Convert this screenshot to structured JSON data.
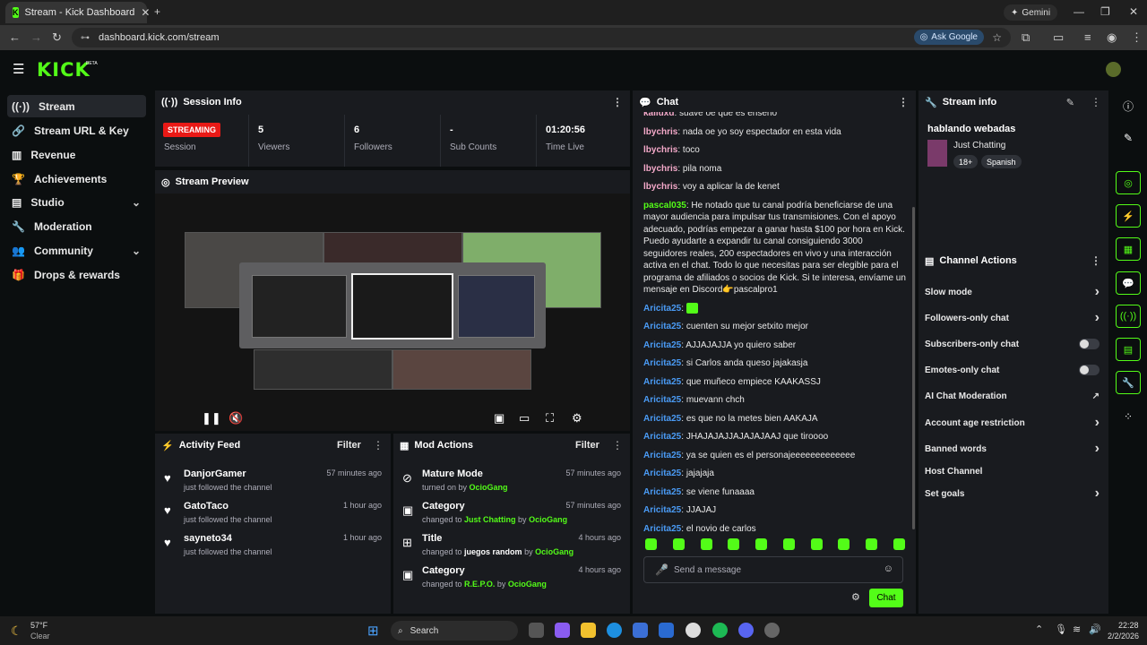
{
  "browser": {
    "tab_title": "Stream - Kick Dashboard",
    "url": "dashboard.kick.com/stream",
    "ask_google": "Ask Google",
    "gemini": "Gemini"
  },
  "header": {
    "logo": "KICK",
    "beta": "BETA"
  },
  "sidebar": {
    "items": [
      {
        "label": "Stream"
      },
      {
        "label": "Stream URL & Key"
      },
      {
        "label": "Revenue"
      },
      {
        "label": "Achievements"
      },
      {
        "label": "Studio"
      },
      {
        "label": "Moderation"
      },
      {
        "label": "Community"
      },
      {
        "label": "Drops & rewards"
      }
    ]
  },
  "session": {
    "title": "Session Info",
    "badge": "STREAMING",
    "session_label": "Session",
    "viewers_value": "5",
    "viewers_label": "Viewers",
    "followers_value": "6",
    "followers_label": "Followers",
    "subs_value": "-",
    "subs_label": "Sub Counts",
    "time_value": "01:20:56",
    "time_label": "Time Live"
  },
  "preview": {
    "title": "Stream Preview"
  },
  "activity": {
    "title": "Activity Feed",
    "filter": "Filter",
    "items": [
      {
        "name": "DanjorGamer",
        "sub": "just followed the channel",
        "time": "57 minutes ago"
      },
      {
        "name": "GatoTaco",
        "sub": "just followed the channel",
        "time": "1 hour ago"
      },
      {
        "name": "sayneto34",
        "sub": "just followed the channel",
        "time": "1 hour ago"
      }
    ]
  },
  "mod": {
    "title": "Mod Actions",
    "filter": "Filter",
    "items": [
      {
        "name": "Mature Mode",
        "pre": "turned on by ",
        "hl1": "OcioGang",
        "mid": "",
        "hl2": "",
        "time": "57 minutes ago"
      },
      {
        "name": "Category",
        "pre": "changed to ",
        "hl1": "Just Chatting",
        "mid": " by ",
        "hl2": "OcioGang",
        "time": "57 minutes ago"
      },
      {
        "name": "Title",
        "pre": "changed to ",
        "hl1": "juegos random",
        "mid": " by ",
        "hl2": "OcioGang",
        "time": "4 hours ago"
      },
      {
        "name": "Category",
        "pre": "changed to ",
        "hl1": "R.E.P.O.",
        "mid": " by ",
        "hl2": "OcioGang",
        "time": "4 hours ago"
      }
    ]
  },
  "chat": {
    "title": "Chat",
    "messages": [
      {
        "user": "kalluxd",
        "color": "pink",
        "text": "suave oe que es enseño"
      },
      {
        "user": "lbychris",
        "color": "pink",
        "text": "nada oe yo soy espectador en esta vida"
      },
      {
        "user": "lbychris",
        "color": "pink",
        "text": "toco"
      },
      {
        "user": "lbychris",
        "color": "pink",
        "text": "pila noma"
      },
      {
        "user": "lbychris",
        "color": "pink",
        "text": "voy a aplicar la de kenet"
      },
      {
        "user": "pascal035",
        "color": "green",
        "text": "He notado que tu canal podría beneficiarse de una mayor audiencia para impulsar tus transmisiones. Con el apoyo adecuado, podrías empezar a ganar hasta $100 por hora en Kick. Puedo ayudarte a expandir tu canal consiguiendo 3000 seguidores reales, 200 espectadores en vivo y una interacción activa en el chat. Todo lo que necesitas para ser elegible para el programa de afiliados o socios de Kick. Si te interesa, envíame un mensaje en Discord👉pascalpro1"
      },
      {
        "user": "Aricita25",
        "color": "blue",
        "text": ""
      },
      {
        "user": "Aricita25",
        "color": "blue",
        "text": "cuenten su mejor setxito mejor"
      },
      {
        "user": "Aricita25",
        "color": "blue",
        "text": "AJJAJAJJA yo quiero saber"
      },
      {
        "user": "Aricita25",
        "color": "blue",
        "text": "si Carlos anda queso jajakasja"
      },
      {
        "user": "Aricita25",
        "color": "blue",
        "text": "que muñeco empiece KAAKASSJ"
      },
      {
        "user": "Aricita25",
        "color": "blue",
        "text": "muevann chch"
      },
      {
        "user": "Aricita25",
        "color": "blue",
        "text": "es que no la metes bien AAKAJA"
      },
      {
        "user": "Aricita25",
        "color": "blue",
        "text": "JHAJAJAJJAJAJAJAAJ que tiroooo"
      },
      {
        "user": "Aricita25",
        "color": "blue",
        "text": "ya se quien es el personajeeeeeeeeeeeee"
      },
      {
        "user": "Aricita25",
        "color": "blue",
        "text": "jajajaja"
      },
      {
        "user": "Aricita25",
        "color": "blue",
        "text": "se viene funaaaa"
      },
      {
        "user": "Aricita25",
        "color": "blue",
        "text": "JJAJAJ"
      },
      {
        "user": "Aricita25",
        "color": "blue",
        "text": "el novio de carlos"
      }
    ],
    "input_placeholder": "Send a message",
    "send_label": "Chat"
  },
  "stream_info": {
    "title": "Stream info",
    "stream_title": "hablando webadas",
    "category": "Just Chatting",
    "tag_age": "18+",
    "tag_lang": "Spanish"
  },
  "channel_actions": {
    "title": "Channel Actions",
    "items": [
      {
        "label": "Slow mode",
        "control": "chevron"
      },
      {
        "label": "Followers-only chat",
        "control": "chevron"
      },
      {
        "label": "Subscribers-only chat",
        "control": "toggle"
      },
      {
        "label": "Emotes-only chat",
        "control": "toggle"
      },
      {
        "label": "AI Chat Moderation",
        "control": "external"
      },
      {
        "label": "Account age restriction",
        "control": "chevron"
      },
      {
        "label": "Banned words",
        "control": "chevron"
      },
      {
        "label": "Host Channel",
        "control": "none"
      },
      {
        "label": "Set goals",
        "control": "chevron"
      }
    ]
  },
  "taskbar": {
    "weather_temp": "57°F",
    "weather_desc": "Clear",
    "search": "Search",
    "time": "22:28",
    "date": "2/2/2026"
  },
  "colors": {
    "accent": "#53fc18",
    "live": "#e91916",
    "panel": "#191b1f"
  }
}
